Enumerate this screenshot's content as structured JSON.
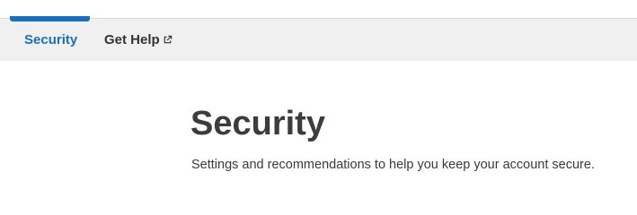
{
  "nav": {
    "tabs": [
      {
        "label": "Security",
        "active": true
      },
      {
        "label": "Get Help",
        "external": true,
        "icon": "external-link-icon"
      }
    ],
    "accent_color": "#1a6fba",
    "background_color": "#f0f0f0"
  },
  "main": {
    "title": "Security",
    "subtitle": "Settings and recommendations to help you keep your account secure."
  }
}
